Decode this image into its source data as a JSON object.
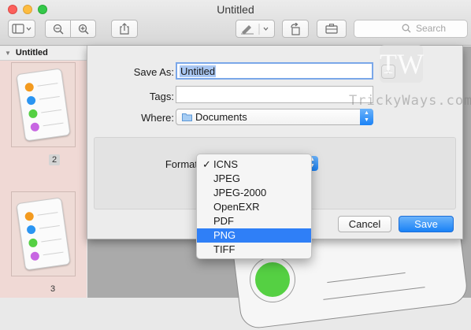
{
  "window": {
    "title": "Untitled"
  },
  "toolbar": {
    "search_placeholder": "Search"
  },
  "sidebar": {
    "header": "Untitled",
    "pages": [
      {
        "number": "2",
        "selected": true
      },
      {
        "number": "3",
        "selected": false
      }
    ]
  },
  "save_sheet": {
    "save_as_label": "Save As:",
    "save_as_value": "Untitled",
    "tags_label": "Tags:",
    "tags_value": "",
    "where_label": "Where:",
    "where_value": "Documents",
    "format_label": "Format",
    "cancel_label": "Cancel",
    "save_label": "Save"
  },
  "format_menu": {
    "items": [
      "ICNS",
      "JPEG",
      "JPEG-2000",
      "OpenEXR",
      "PDF",
      "PNG",
      "TIFF"
    ],
    "checked": "ICNS",
    "highlighted": "PNG"
  },
  "watermark": {
    "logo": "TW",
    "text": "TrickyWays.com"
  },
  "colors": {
    "accent": "#2f7ff7",
    "sidebar_selected": "#f0d9d5",
    "dot_orange": "#f39a1f",
    "dot_blue": "#2b95f2",
    "dot_green": "#55d043",
    "dot_purple": "#c766e2"
  }
}
